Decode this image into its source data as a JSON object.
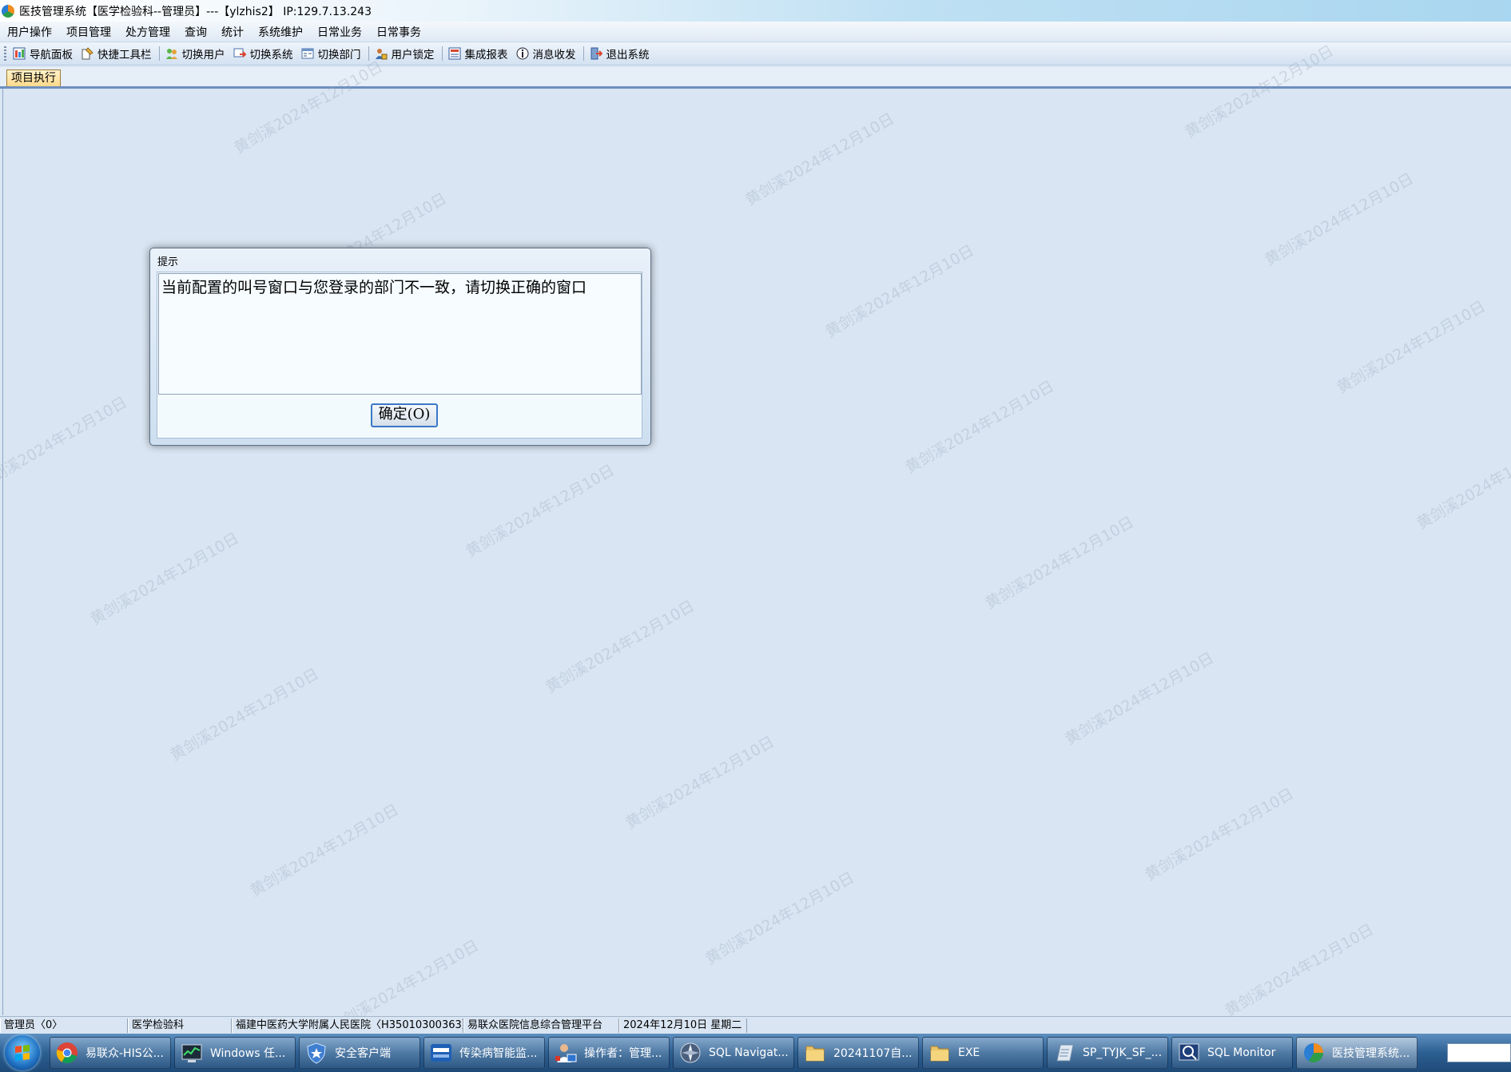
{
  "window": {
    "title": "医技管理系统【医学检验科--管理员】---【ylzhis2】 IP:129.7.13.243"
  },
  "menu": [
    "用户操作",
    "项目管理",
    "处方管理",
    "查询",
    "统计",
    "系统维护",
    "日常业务",
    "日常事务"
  ],
  "toolbar": {
    "nav_panel": "导航面板",
    "quick_toolbar": "快捷工具栏",
    "switch_user": "切换用户",
    "switch_system": "切换系统",
    "switch_dept": "切换部门",
    "user_lock": "用户锁定",
    "integrated_report": "集成报表",
    "message": "消息收发",
    "exit": "退出系统"
  },
  "tabs": {
    "active": "项目执行"
  },
  "dialog": {
    "title": "提示",
    "message": "当前配置的叫号窗口与您登录的部门不一致，请切换正确的窗口",
    "ok_label": "确定(O)"
  },
  "statusbar": {
    "user": "管理员〈0〉",
    "dept": "医学检验科",
    "hospital": "福建中医药大学附属人民医院〈H35010300363〉",
    "platform": "易联众医院信息综合管理平台",
    "date": "2024年12月10日  星期二"
  },
  "watermark": "黄剑溪2024年12月10日",
  "taskbar": [
    {
      "label": "易联众-HIS公...",
      "icon": "chrome-icon"
    },
    {
      "label": "Windows 任...",
      "icon": "task-manager-icon"
    },
    {
      "label": "安全客户端",
      "icon": "shield-icon"
    },
    {
      "label": "传染病智能监...",
      "icon": "adcpa-icon"
    },
    {
      "label": "操作者：管理...",
      "icon": "doctor-icon"
    },
    {
      "label": "SQL Navigat...",
      "icon": "compass-icon"
    },
    {
      "label": "20241107自...",
      "icon": "folder-icon"
    },
    {
      "label": "EXE",
      "icon": "folder-icon"
    },
    {
      "label": "SP_TYJK_SF_...",
      "icon": "script-icon"
    },
    {
      "label": "SQL Monitor",
      "icon": "sql-monitor-icon"
    },
    {
      "label": "医技管理系统...",
      "icon": "app-icon"
    }
  ]
}
